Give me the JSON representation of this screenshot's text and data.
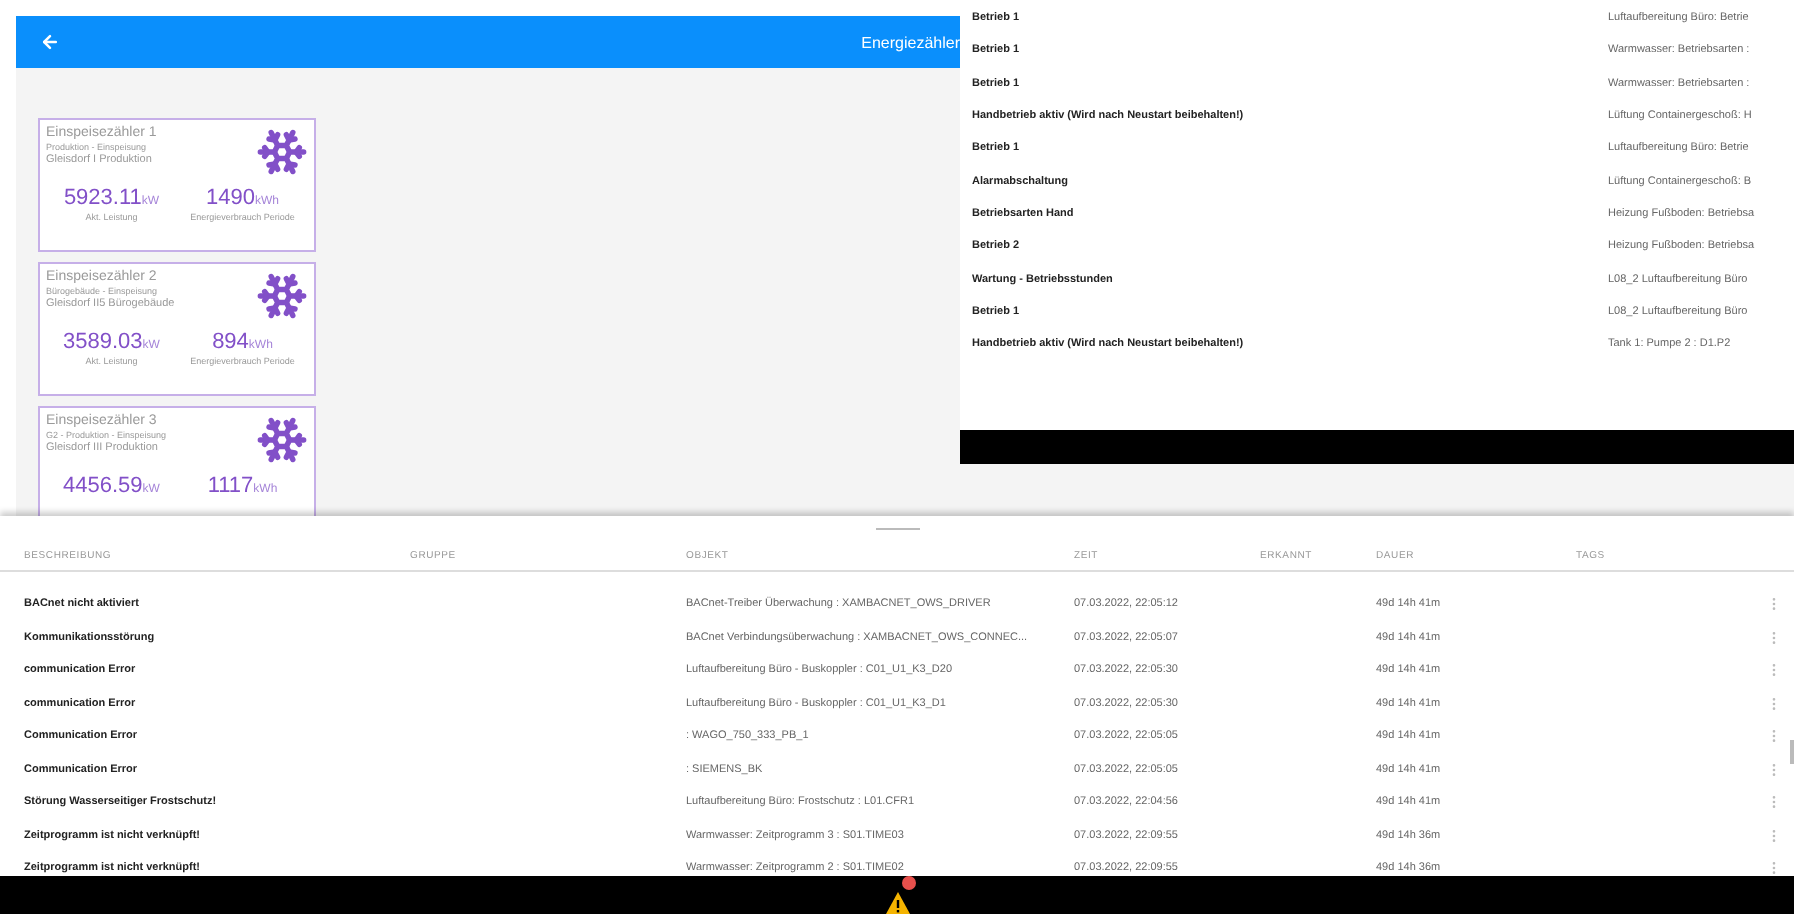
{
  "header": {
    "title": "Energiezähler"
  },
  "meters": [
    {
      "title": "Einspeisezähler 1",
      "subtitle": "Produktion - Einspeisung",
      "location": "Gleisdorf I Produktion",
      "power": "5923.11",
      "power_unit": "kW",
      "power_label": "Akt. Leistung",
      "energy": "1490",
      "energy_unit": "kWh",
      "energy_label": "Energieverbrauch Periode"
    },
    {
      "title": "Einspeisezähler 2",
      "subtitle": "Bürogebäude - Einspeisung",
      "location": "Gleisdorf II5 Bürogebäude",
      "power": "3589.03",
      "power_unit": "kW",
      "power_label": "Akt. Leistung",
      "energy": "894",
      "energy_unit": "kWh",
      "energy_label": "Energieverbrauch Periode"
    },
    {
      "title": "Einspeisezähler 3",
      "subtitle": "G2 - Produktion - Einspeisung",
      "location": "Gleisdorf III Produktion",
      "power": "4456.59",
      "power_unit": "kW",
      "energy": "1117",
      "energy_unit": "kWh"
    }
  ],
  "side_list": [
    {
      "name": "Betrieb 1",
      "object": "Luftaufbereitung Büro: Betrie"
    },
    {
      "name": "Betrieb 1",
      "object": "Warmwasser: Betriebsarten :"
    },
    {
      "name": "Betrieb 1",
      "object": "Warmwasser: Betriebsarten :"
    },
    {
      "name": "Handbetrieb aktiv (Wird nach Neustart beibehalten!)",
      "object": "Lüftung Containergeschoß: H"
    },
    {
      "name": "Betrieb 1",
      "object": "Luftaufbereitung Büro: Betrie"
    },
    {
      "name": "Alarmabschaltung",
      "object": "Lüftung Containergeschoß: B"
    },
    {
      "name": "Betriebsarten Hand",
      "object": "Heizung Fußboden: Betriebsa"
    },
    {
      "name": "Betrieb 2",
      "object": "Heizung Fußboden: Betriebsa"
    },
    {
      "name": "Wartung - Betriebsstunden",
      "object": "L08_2 Luftaufbereitung Büro"
    },
    {
      "name": "Betrieb 1",
      "object": "L08_2 Luftaufbereitung Büro"
    },
    {
      "name": "Handbetrieb aktiv (Wird nach Neustart beibehalten!)",
      "object": "Tank 1: Pumpe 2 : D1.P2"
    }
  ],
  "alarm_table": {
    "columns": [
      "BESCHREIBUNG",
      "GRUPPE",
      "OBJEKT",
      "ZEIT",
      "ERKANNT",
      "DAUER",
      "TAGS"
    ],
    "rows": [
      {
        "description": "BACnet nicht aktiviert",
        "object": "BACnet-Treiber Überwachung : XAMBACNET_OWS_DRIVER",
        "time": "07.03.2022, 22:05:12",
        "duration": "49d 14h 41m"
      },
      {
        "description": "Kommunikationsstörung",
        "object": "BACnet Verbindungsüberwachung : XAMBACNET_OWS_CONNEC...",
        "time": "07.03.2022, 22:05:07",
        "duration": "49d 14h 41m"
      },
      {
        "description": "communication Error",
        "object": "Luftaufbereitung Büro - Buskoppler : C01_U1_K3_D20",
        "time": "07.03.2022, 22:05:30",
        "duration": "49d 14h 41m"
      },
      {
        "description": "communication Error",
        "object": "Luftaufbereitung Büro - Buskoppler : C01_U1_K3_D1",
        "time": "07.03.2022, 22:05:30",
        "duration": "49d 14h 41m"
      },
      {
        "description": "Communication Error",
        "object": ": WAGO_750_333_PB_1",
        "time": "07.03.2022, 22:05:05",
        "duration": "49d 14h 41m"
      },
      {
        "description": "Communication Error",
        "object": ": SIEMENS_BK",
        "time": "07.03.2022, 22:05:05",
        "duration": "49d 14h 41m"
      },
      {
        "description": "Störung Wasserseitiger Frostschutz!",
        "object": "Luftaufbereitung Büro: Frostschutz : L01.CFR1",
        "time": "07.03.2022, 22:04:56",
        "duration": "49d 14h 41m"
      },
      {
        "description": "Zeitprogramm ist nicht verknüpft!",
        "object": "Warmwasser: Zeitprogramm 3 : S01.TIME03",
        "time": "07.03.2022, 22:09:55",
        "duration": "49d 14h 36m"
      },
      {
        "description": "Zeitprogramm ist nicht verknüpft!",
        "object": "Warmwasser: Zeitprogramm 2 : S01.TIME02",
        "time": "07.03.2022, 22:09:55",
        "duration": "49d 14h 36m"
      }
    ]
  }
}
